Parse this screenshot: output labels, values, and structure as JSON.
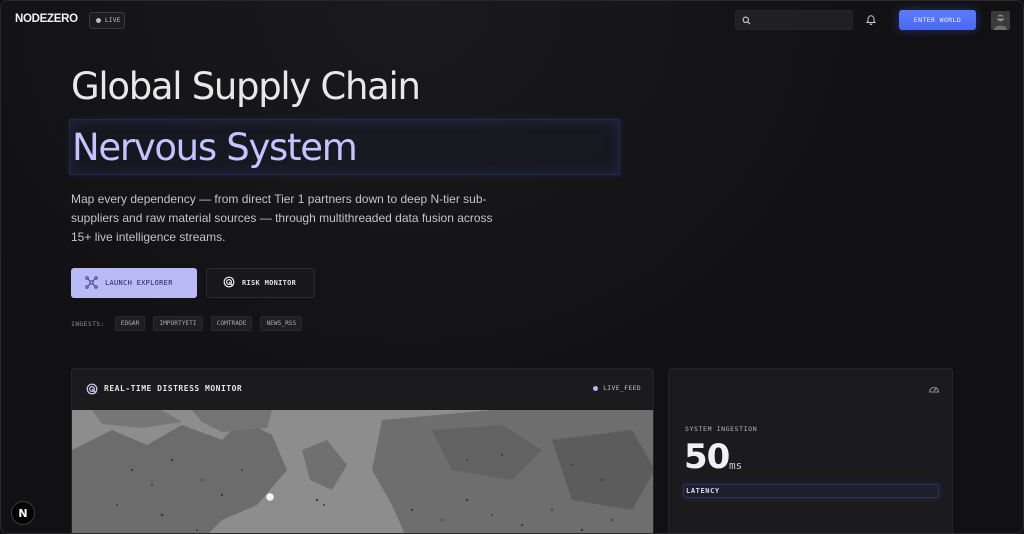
{
  "nav": {
    "logo": "NODEZERO",
    "live_badge": "LIVE",
    "search_placeholder": "",
    "enter_button": "ENTER WORLD"
  },
  "hero": {
    "title_line1": "Global Supply Chain",
    "title_line2": "Nervous System",
    "description": "Map every dependency — from direct Tier 1 partners down to deep N-tier sub-suppliers and raw material sources — through multithreaded data fusion across 15+ live intelligence streams.",
    "primary_button": "LAUNCH EXPLORER",
    "secondary_button": "RISK MONITOR",
    "ingests_label": "INGESTS:",
    "ingests": [
      "EDGAR",
      "IMPORTYETI",
      "COMTRADE",
      "NEWS_RSS"
    ]
  },
  "monitor": {
    "title": "REAL-TIME DISTRESS MONITOR",
    "feed_label": "LIVE_FEED"
  },
  "ingestion": {
    "label": "SYSTEM INGESTION",
    "value": "50",
    "unit": "ms",
    "latency_label": "LATENCY"
  },
  "badge": {
    "letter": "N"
  },
  "colors": {
    "accent_lavender": "#b9bbf6",
    "accent_text": "#c3c4ff",
    "enter_button": "#4a68f0",
    "background": "#111113"
  },
  "icons": {
    "search": "search-icon",
    "bell": "bell-icon",
    "explorer": "network-icon",
    "risk": "radar-icon",
    "monitor": "radar-icon",
    "ingestion": "gauge-icon"
  }
}
